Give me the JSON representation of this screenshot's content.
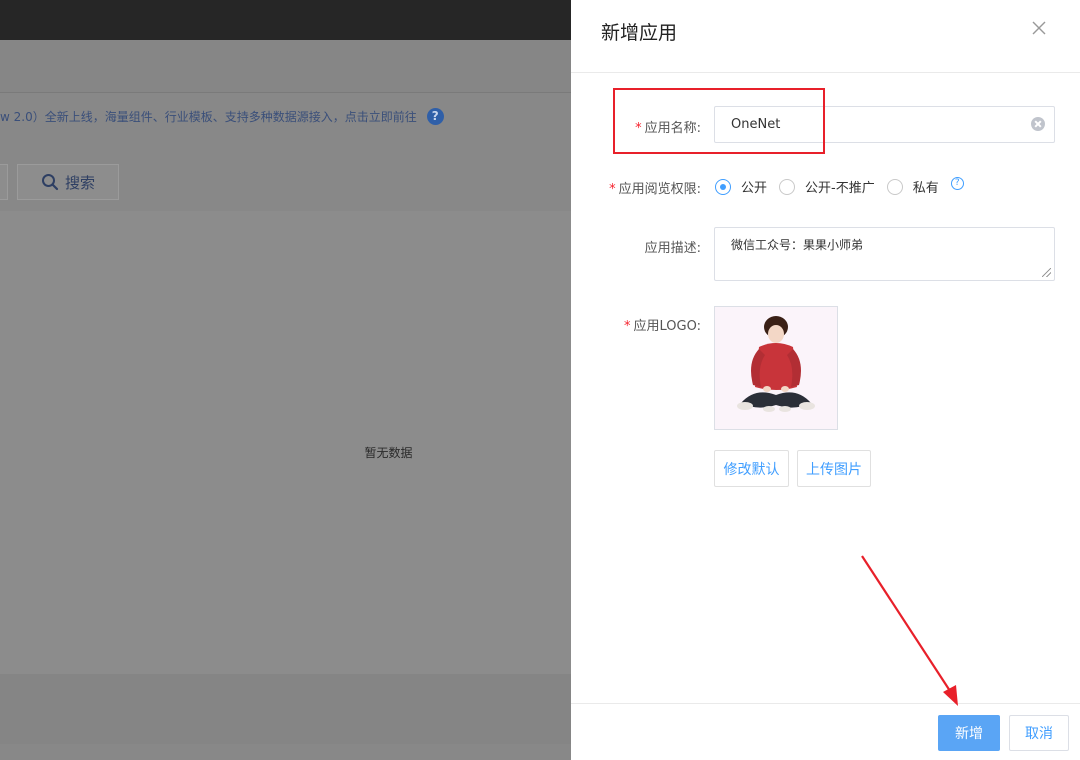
{
  "background": {
    "notice_text": "w 2.0）全新上线，海量组件、行业模板、支持多种数据源接入，点击立即前往",
    "help_icon_text": "?",
    "search_button_label": "搜索",
    "empty_text": "暂无数据"
  },
  "drawer": {
    "title": "新增应用",
    "form": {
      "name_label": "应用名称:",
      "name_value": "OneNet",
      "permission_label": "应用阅览权限:",
      "permission_options": [
        "公开",
        "公开-不推广",
        "私有"
      ],
      "permission_selected": "公开",
      "permission_help": "?",
      "desc_label": "应用描述:",
      "desc_value": "微信工众号：果果小师弟",
      "logo_label": "应用LOGO:",
      "modify_default_label": "修改默认",
      "upload_image_label": "上传图片"
    },
    "footer": {
      "submit_label": "新增",
      "cancel_label": "取消"
    }
  },
  "colors": {
    "primary": "#409eff",
    "primary_button": "#5aa5f5",
    "annotation_red": "#e8202a",
    "required_star": "#f5222d",
    "overlay_gray": "#888888"
  },
  "icons": {
    "close": "close-icon",
    "clear": "clear-icon",
    "search": "search-icon",
    "help": "help-icon"
  }
}
